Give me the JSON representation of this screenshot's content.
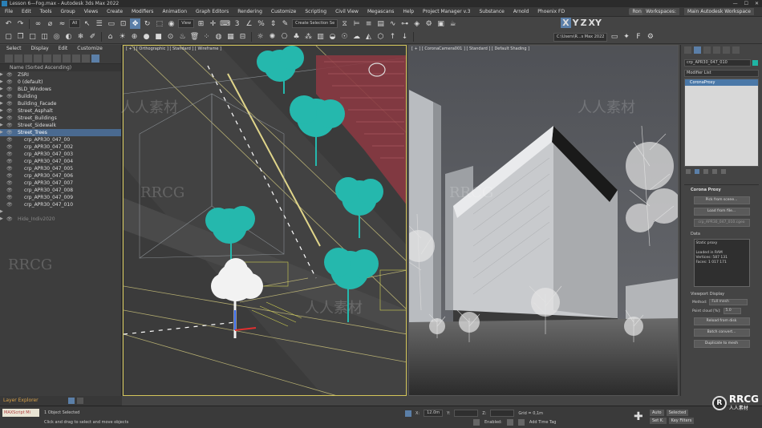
{
  "window": {
    "title": "Lesson 6—Fog.max - Autodesk 3ds Max 2022"
  },
  "menubar": {
    "items": [
      "File",
      "Edit",
      "Tools",
      "Group",
      "Views",
      "Create",
      "Modifiers",
      "Animation",
      "Graph Editors",
      "Rendering",
      "Customize",
      "Scripting",
      "Civil View",
      "Megascans",
      "Help",
      "Project Manager v.3",
      "Substance",
      "Arnold",
      "Phoenix FD"
    ],
    "user": "Ron Wittmann",
    "workspaces": [
      "Workspaces:",
      "Main Autodesk Workspace"
    ]
  },
  "toolbar": {
    "view_dropdown": "All",
    "ref_dropdown": "View",
    "selection_set": "Create Selection Se",
    "axis_buttons": [
      "X",
      "Y",
      "Z",
      "XY"
    ],
    "project_dropdown": "C:\\Users\\R...s Max 2022"
  },
  "scene_explorer": {
    "menu": [
      "Select",
      "Display",
      "Edit",
      "Customize"
    ],
    "column_header": "Name (Sorted Ascending)",
    "rows": [
      {
        "label": "ZSRI",
        "indent": 1,
        "state": "normal"
      },
      {
        "label": "0 (default)",
        "indent": 1,
        "state": "normal"
      },
      {
        "label": "BLD_Windows",
        "indent": 1,
        "state": "normal"
      },
      {
        "label": "Building",
        "indent": 1,
        "state": "normal"
      },
      {
        "label": "Building_Facade",
        "indent": 1,
        "state": "normal"
      },
      {
        "label": "Street_Asphalt",
        "indent": 1,
        "state": "normal"
      },
      {
        "label": "Street_Buildings",
        "indent": 1,
        "state": "normal"
      },
      {
        "label": "Street_Sidewalk",
        "indent": 1,
        "state": "normal"
      },
      {
        "label": "Street_Trees",
        "indent": 1,
        "state": "selected"
      },
      {
        "label": "crp_APR30_047_00",
        "indent": 2,
        "state": "normal"
      },
      {
        "label": "crp_APR30_047_002",
        "indent": 2,
        "state": "normal"
      },
      {
        "label": "crp_APR30_047_003",
        "indent": 2,
        "state": "normal"
      },
      {
        "label": "crp_APR30_047_004",
        "indent": 2,
        "state": "normal"
      },
      {
        "label": "crp_APR30_047_005",
        "indent": 2,
        "state": "normal"
      },
      {
        "label": "crp_APR30_047_006",
        "indent": 2,
        "state": "normal"
      },
      {
        "label": "crp_APR30_047_007",
        "indent": 2,
        "state": "normal"
      },
      {
        "label": "crp_APR30_047_008",
        "indent": 2,
        "state": "normal"
      },
      {
        "label": "crp_APR30_047_009",
        "indent": 2,
        "state": "normal"
      },
      {
        "label": "crp_APR30_047_010",
        "indent": 2,
        "state": "normal"
      },
      {
        "label": "",
        "indent": 1,
        "state": "normal"
      },
      {
        "label": "Hide_Indiv2020",
        "indent": 1,
        "state": "dim"
      }
    ]
  },
  "layer_explorer": {
    "label": "Layer Explorer"
  },
  "viewports": {
    "left_label": "[ + ] [ Orthographic ] [ Standard ] [ Wireframe ]",
    "right_label": "[ + ] [ CoronaCamera001 ] [ Standard ] [ Default Shading ]"
  },
  "command_panel": {
    "object_name": "crp_APR30_047_010",
    "object_color": "#1fb5a4",
    "modifier_list": "Modifier List",
    "stack_item": "CoronaProxy",
    "rollout_title": "Corona Proxy",
    "buttons": [
      "Pick from scene...",
      "Load from file...",
      "crp_APR30_047_010.cgeo"
    ],
    "data_label": "Data",
    "info_lines": [
      "Static proxy",
      "",
      "Loaded in RAM",
      "Vertices: 587 131",
      "Faces: 1 017 171"
    ],
    "viewport_display": "Viewport Display",
    "method_label": "Method:",
    "method_value": "Full mesh",
    "point_cloud_label": "Point cloud [%]:",
    "point_cloud_value": "5.0",
    "buttons2": [
      "Reload from disk",
      "Batch convert...",
      "Duplicate to mesh"
    ]
  },
  "status_bar": {
    "maxscript": "MAXScript Mi",
    "selection": "1 Object Selected",
    "prompt": "Click and drag to select and move objects",
    "x_label": "X:",
    "x_value": "12.0m",
    "y_label": "Y:",
    "y_value": "",
    "z_label": "Z:",
    "z_value": "",
    "grid": "Grid = 0,1m",
    "enabled": "Enabled:",
    "add_time_tag": "Add Time Tag",
    "auto": "Auto",
    "selected": "Selected",
    "set_key": "Set K.",
    "key_filters": "Key Filters"
  },
  "watermark": {
    "text1": "RRCG",
    "text2": "人人素材",
    "logo_text": "RRCG",
    "logo_sub": "人人素材"
  }
}
